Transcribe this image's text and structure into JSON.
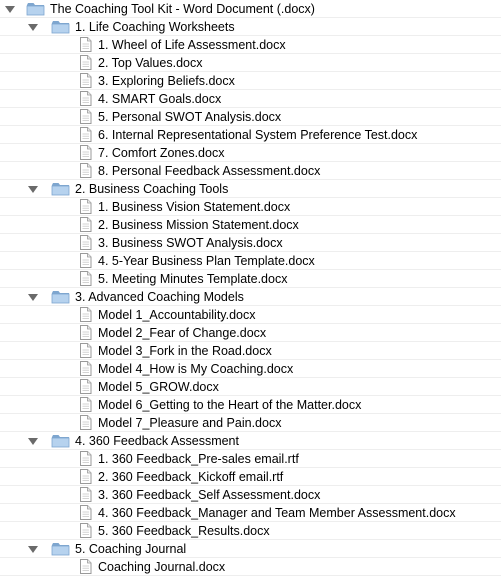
{
  "root": {
    "label": "The Coaching Tool Kit - Word Document (.docx)",
    "icon": "folder-icon"
  },
  "folders": [
    {
      "label": "1. Life Coaching Worksheets",
      "files": [
        {
          "label": "1. Wheel of Life Assessment.docx"
        },
        {
          "label": "2. Top Values.docx"
        },
        {
          "label": "3. Exploring Beliefs.docx"
        },
        {
          "label": "4. SMART Goals.docx"
        },
        {
          "label": "5. Personal SWOT Analysis.docx"
        },
        {
          "label": "6. Internal Representational System Preference Test.docx"
        },
        {
          "label": "7. Comfort Zones.docx"
        },
        {
          "label": "8. Personal Feedback Assessment.docx"
        }
      ]
    },
    {
      "label": "2. Business Coaching Tools",
      "files": [
        {
          "label": "1. Business Vision Statement.docx"
        },
        {
          "label": "2. Business Mission Statement.docx"
        },
        {
          "label": "3. Business SWOT Analysis.docx"
        },
        {
          "label": "4. 5-Year Business Plan Template.docx"
        },
        {
          "label": "5. Meeting Minutes Template.docx"
        }
      ]
    },
    {
      "label": "3. Advanced Coaching Models",
      "files": [
        {
          "label": "Model 1_Accountability.docx"
        },
        {
          "label": "Model 2_Fear of Change.docx"
        },
        {
          "label": "Model 3_Fork in the Road.docx"
        },
        {
          "label": "Model 4_How is My Coaching.docx"
        },
        {
          "label": "Model 5_GROW.docx"
        },
        {
          "label": "Model 6_Getting to the Heart of the Matter.docx"
        },
        {
          "label": "Model 7_Pleasure and Pain.docx"
        }
      ]
    },
    {
      "label": "4. 360 Feedback Assessment",
      "files": [
        {
          "label": "1. 360 Feedback_Pre-sales email.rtf"
        },
        {
          "label": "2. 360 Feedback_Kickoff email.rtf"
        },
        {
          "label": "3. 360 Feedback_Self Assessment.docx"
        },
        {
          "label": "4. 360 Feedback_Manager and Team Member Assessment.docx"
        },
        {
          "label": "5. 360 Feedback_Results.docx"
        }
      ]
    },
    {
      "label": "5. Coaching Journal",
      "files": [
        {
          "label": "Coaching Journal.docx"
        }
      ]
    }
  ],
  "icons": {
    "disclosure": "disclosure-triangle-icon",
    "folder": "folder-icon",
    "file": "document-icon"
  },
  "colors": {
    "folder_light": "#b6d2ee",
    "folder_dark": "#7ea6cf",
    "triangle": "#6a6a6a",
    "doc_border": "#9a9a9a"
  }
}
